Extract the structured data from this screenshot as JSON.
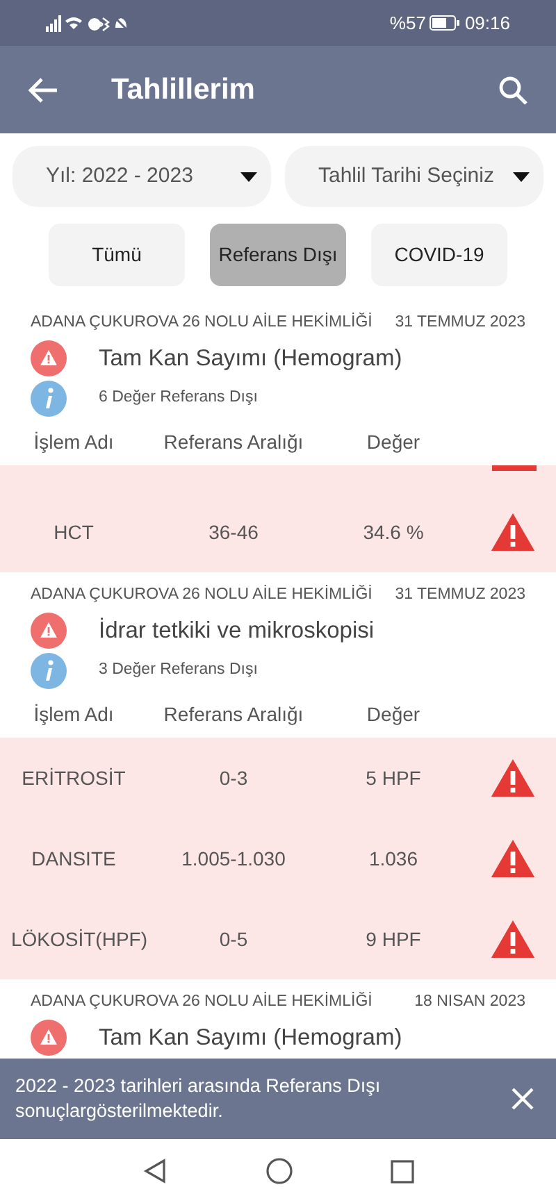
{
  "status_bar": {
    "battery": "%57",
    "time": "09:16"
  },
  "app_bar": {
    "title": "Tahlillerim"
  },
  "filters": [
    {
      "value": "Yıl: 2022 - 2023"
    },
    {
      "value": "Tahlil Tarihi Seçiniz"
    }
  ],
  "chips": [
    {
      "label": "Tümü",
      "selected": false
    },
    {
      "label": "Referans Dışı",
      "selected": true
    },
    {
      "label": "COVID-19",
      "selected": false
    }
  ],
  "results": [
    {
      "facility": "ADANA ÇUKUROVA 26 NOLU AİLE HEKİMLİĞİ",
      "date": "31 TEMMUZ 2023",
      "title": "Tam Kan Sayımı (Hemogram)",
      "summary": "6 Değer Referans Dışı",
      "columns": [
        "İşlem Adı",
        "Referans Aralığı",
        "Değer"
      ],
      "clipped_row_above": true,
      "rows": [
        {
          "name": "HCT",
          "range": "36-46",
          "value": "34.6 %",
          "out_of_range": true
        }
      ]
    },
    {
      "facility": "ADANA ÇUKUROVA 26 NOLU AİLE HEKİMLİĞİ",
      "date": "31 TEMMUZ 2023",
      "title": "İdrar tetkiki ve mikroskopisi",
      "summary": "3 Değer Referans Dışı",
      "columns": [
        "İşlem Adı",
        "Referans Aralığı",
        "Değer"
      ],
      "clipped_row_above": false,
      "rows": [
        {
          "name": "ERİTROSİT",
          "range": "0-3",
          "value": "5 HPF",
          "out_of_range": true
        },
        {
          "name": "DANSITE",
          "range": "1.005-1.030",
          "value": "1.036",
          "out_of_range": true
        },
        {
          "name": "LÖKOSİT(HPF)",
          "range": "0-5",
          "value": "9 HPF",
          "out_of_range": true
        }
      ]
    },
    {
      "facility": "ADANA ÇUKUROVA 26 NOLU AİLE HEKİMLİĞİ",
      "date": "18 NISAN 2023",
      "title": "Tam Kan Sayımı (Hemogram)"
    }
  ],
  "snackbar": {
    "message": "2022 - 2023 tarihleri arasında Referans Dışı sonuçlargösterilmektedir."
  }
}
